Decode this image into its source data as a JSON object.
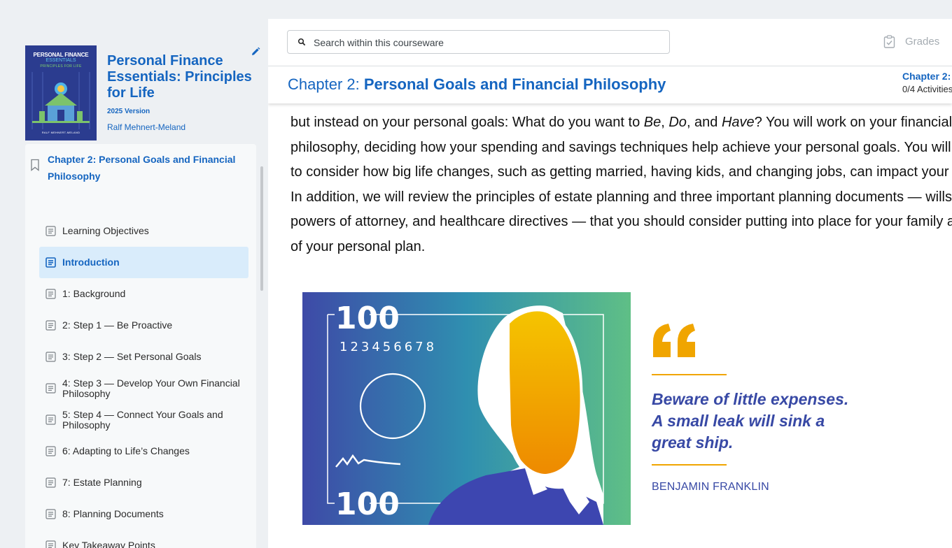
{
  "book": {
    "cover_title": "PERSONAL FINANCE",
    "cover_sub": "ESSENTIALS",
    "cover_tagline": "PRINCIPLES FOR LIFE",
    "cover_author": "RALF MEHNERT-MELAND",
    "title": "Personal Finance Essentials: Principles for Life",
    "version": "2025 Version",
    "author": "Ralf Mehnert-Meland"
  },
  "toc": {
    "chapter_title": "Chapter 2: Personal Goals and Financial Philosophy",
    "items": [
      {
        "label": "Learning Objectives",
        "active": false
      },
      {
        "label": "Introduction",
        "active": true
      },
      {
        "label": "1: Background",
        "active": false
      },
      {
        "label": "2: Step 1 — Be Proactive",
        "active": false
      },
      {
        "label": "3: Step 2 — Set Personal Goals",
        "active": false
      },
      {
        "label": "4: Step 3 — Develop Your Own Financial Philosophy",
        "active": false
      },
      {
        "label": "5: Step 4 — Connect Your Goals and Philosophy",
        "active": false
      },
      {
        "label": "6: Adapting to Life’s Changes",
        "active": false
      },
      {
        "label": "7: Estate Planning",
        "active": false
      },
      {
        "label": "8: Planning Documents",
        "active": false
      },
      {
        "label": "Key Takeaway Points",
        "active": false
      }
    ]
  },
  "search": {
    "placeholder": "Search within this courseware"
  },
  "grades_label": "Grades",
  "chapter_bar": {
    "prefix": "Chapter 2: ",
    "title": "Personal Goals and Financial Philosophy",
    "progress_label": "Chapter 2:",
    "progress_count": "0/4 Activities"
  },
  "content": {
    "lines": [
      [
        "but instead on your personal goals: What do you want to ",
        {
          "i": "Be"
        },
        ", ",
        {
          "i": "Do"
        },
        ", and ",
        {
          "i": "Have"
        },
        "? You will work on your financial"
      ],
      [
        "philosophy, deciding how your spending and savings techniques help achieve your personal goals. You will learn"
      ],
      [
        "to consider how big life changes, such as getting married, having kids, and changing jobs, can impact your plans."
      ],
      [
        "In addition, we will review the principles of estate planning and three important planning documents — wills,"
      ],
      [
        "powers of attorney, and healthcare directives — that you should consider putting into place for your family as part"
      ],
      [
        "of your personal plan."
      ]
    ],
    "banknote_value_top": "100",
    "banknote_serial": "123456678",
    "banknote_value_bottom": "100",
    "quote": "Beware of little expenses. A small leak will sink a great ship.",
    "quote_author": "BENJAMIN FRANKLIN"
  },
  "icons": {
    "pencil": "pencil-icon",
    "bookmark": "bookmark-icon",
    "doc": "document-icon",
    "search": "search-icon",
    "grades": "clipboard-check-icon"
  },
  "colors": {
    "brand_blue": "#1565c0",
    "active_bg": "#d9ecfb",
    "quote_blue": "#3849a5",
    "accent_orange": "#f0a500"
  }
}
